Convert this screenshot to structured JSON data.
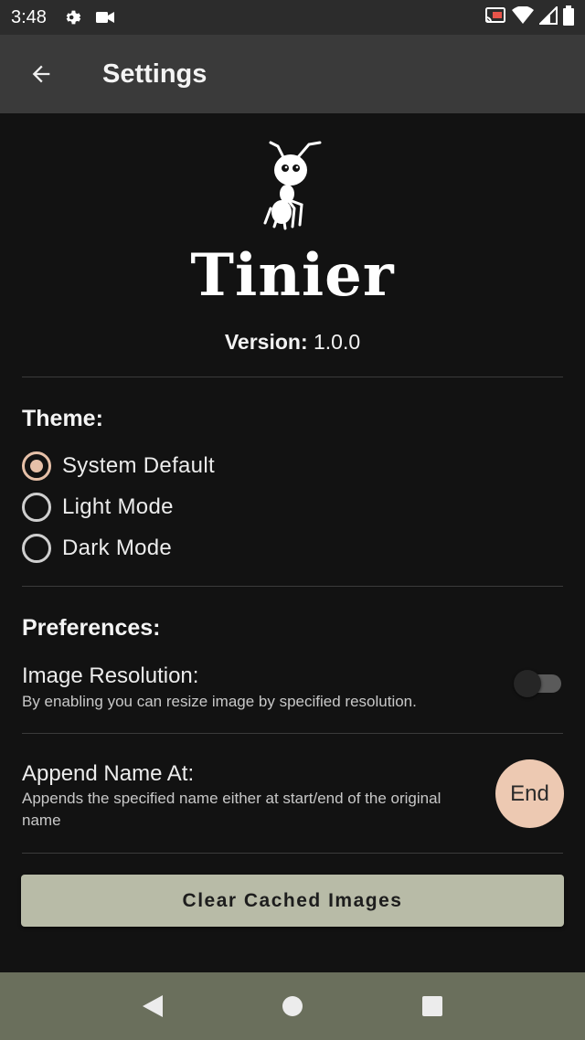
{
  "status_bar": {
    "time": "3:48",
    "left_icons": [
      "gear-icon",
      "video-camera-icon"
    ],
    "right_icons": [
      "cast-icon",
      "wifi-icon",
      "signal-icon",
      "battery-icon"
    ]
  },
  "app_bar": {
    "title": "Settings",
    "back_icon": "arrow-left-icon"
  },
  "about": {
    "app_name": "Tinier",
    "version_label": "Version:",
    "version_value": "1.0.0",
    "logo_icon": "ant-logo-icon"
  },
  "theme": {
    "title": "Theme:",
    "options": [
      {
        "label": "System Default",
        "selected": true
      },
      {
        "label": "Light Mode",
        "selected": false
      },
      {
        "label": "Dark Mode",
        "selected": false
      }
    ]
  },
  "preferences": {
    "title": "Preferences:",
    "image_resolution": {
      "title": "Image Resolution:",
      "description": "By enabling you can resize image by specified resolution.",
      "enabled": false
    },
    "append_name": {
      "title": "Append Name At:",
      "description": "Appends the specified name either at start/end of the original name",
      "value": "End"
    }
  },
  "clear_button_label": "Clear Cached Images",
  "nav_bar": {
    "icons": [
      "back-triangle-icon",
      "home-circle-icon",
      "recents-square-icon"
    ]
  },
  "colors": {
    "accent": "#e6c0a8",
    "button": "#b8bba7",
    "navbar": "#6a6f5c",
    "appbar": "#3a3a3a",
    "background": "#121212"
  }
}
